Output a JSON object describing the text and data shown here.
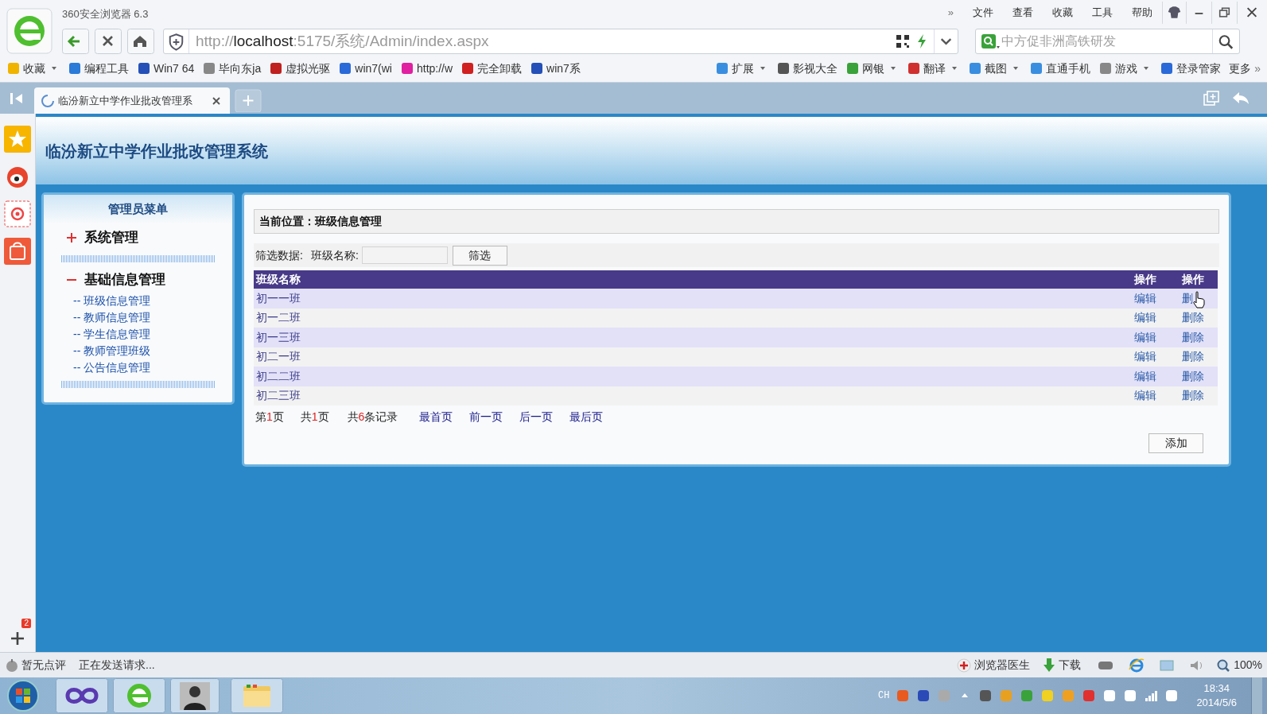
{
  "browser": {
    "title": "360安全浏览器 6.3",
    "menu_overflow": "»",
    "menu": [
      "文件",
      "查看",
      "收藏",
      "工具",
      "帮助"
    ],
    "url": {
      "scheme": "http://",
      "host": "localhost",
      "path": ":5175/系统/Admin/index.aspx"
    },
    "search": {
      "placeholder": "中方促非洲高铁研发"
    },
    "bookmarks": [
      {
        "label": "收藏",
        "dropdown": true
      },
      {
        "label": "编程工具",
        "dropdown": false
      },
      {
        "label": "Win7 64",
        "dropdown": false
      },
      {
        "label": "毕向东ja",
        "dropdown": false
      },
      {
        "label": "虚拟光驱",
        "dropdown": false
      },
      {
        "label": "win7(wi",
        "dropdown": false
      },
      {
        "label": "http://w",
        "dropdown": false
      },
      {
        "label": "完全卸载",
        "dropdown": false
      },
      {
        "label": "win7系",
        "dropdown": false
      }
    ],
    "extras": [
      {
        "label": "扩展",
        "dropdown": true
      },
      {
        "label": "影视大全",
        "dropdown": false
      },
      {
        "label": "网银",
        "dropdown": true
      },
      {
        "label": "翻译",
        "dropdown": true
      },
      {
        "label": "截图",
        "dropdown": true
      },
      {
        "label": "直通手机",
        "dropdown": false
      },
      {
        "label": "游戏",
        "dropdown": true
      },
      {
        "label": "登录管家",
        "dropdown": false
      },
      {
        "label": "更多"
      }
    ],
    "extras_overflow": "»",
    "tabs": [
      {
        "title": "临汾新立中学作业批改管理系",
        "selected": true
      }
    ],
    "sidebar_badge": "2"
  },
  "page": {
    "title": "临汾新立中学作业批改管理系统",
    "menu": {
      "title": "管理员菜单",
      "groups": [
        {
          "label": "系统管理",
          "expanded": false
        },
        {
          "label": "基础信息管理",
          "expanded": true,
          "children": [
            "-- 班级信息管理",
            "-- 教师信息管理",
            "-- 学生信息管理",
            "-- 教师管理班级",
            "-- 公告信息管理"
          ]
        }
      ]
    },
    "breadcrumb": "当前位置：班级信息管理",
    "filter": {
      "label": "筛选数据:",
      "field_label": "班级名称:",
      "button": "筛选"
    },
    "table": {
      "columns": [
        "班级名称",
        "操作",
        "操作"
      ],
      "rows": [
        {
          "name": "初一一班",
          "edit": "编辑",
          "delete": "删"
        },
        {
          "name": "初一二班",
          "edit": "编辑",
          "delete": "删除"
        },
        {
          "name": "初一三班",
          "edit": "编辑",
          "delete": "删除"
        },
        {
          "name": "初二一班",
          "edit": "编辑",
          "delete": "删除"
        },
        {
          "name": "初二二班",
          "edit": "编辑",
          "delete": "删除"
        },
        {
          "name": "初二三班",
          "edit": "编辑",
          "delete": "删除"
        }
      ]
    },
    "pager": [
      {
        "kind": "count",
        "prefix": "第",
        "num": "1",
        "suffix": "页"
      },
      {
        "kind": "count",
        "prefix": "共",
        "num": "1",
        "suffix": "页"
      },
      {
        "kind": "count",
        "prefix": "共",
        "num": "6",
        "suffix": "条记录"
      },
      {
        "kind": "link",
        "text": "最首页"
      },
      {
        "kind": "link",
        "text": "前一页"
      },
      {
        "kind": "link",
        "text": "后一页"
      },
      {
        "kind": "link",
        "text": "最后页"
      }
    ],
    "add_button": "添加"
  },
  "status_bar": {
    "left": [
      "暂无点评",
      "正在发送请求..."
    ],
    "doctor": "浏览器医生",
    "download": "下载",
    "zoom": "100%"
  },
  "taskbar": {
    "lang": "CH",
    "time": "18:34",
    "date": "2014/5/6"
  }
}
